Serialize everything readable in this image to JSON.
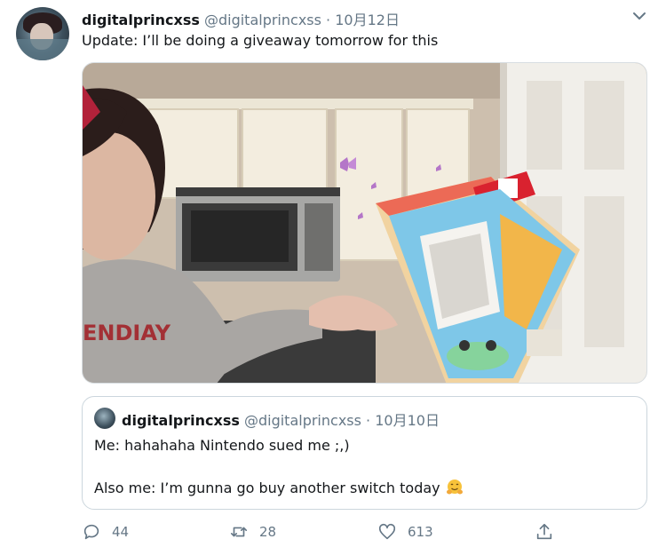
{
  "tweet": {
    "display_name": "digitalprincxss",
    "handle": "@digitalprincxss",
    "separator": "·",
    "date": "10月12日",
    "text": "Update: I’ll be doing a giveaway tomorrow for this"
  },
  "quote": {
    "display_name": "digitalprincxss",
    "handle": "@digitalprincxss",
    "separator": "·",
    "date": "10月10日",
    "line1": "Me: hahahaha Nintendo sued me ;,)",
    "line2": "Also me: I’m gunna go buy another switch today"
  },
  "actions": {
    "replies": "44",
    "retweets": "28",
    "likes": "613"
  },
  "photo": {
    "sweatshirt_text": "ENDIAY"
  },
  "colors": {
    "text": "#14171a",
    "secondary": "#657786",
    "border": "#ccd6dd"
  }
}
